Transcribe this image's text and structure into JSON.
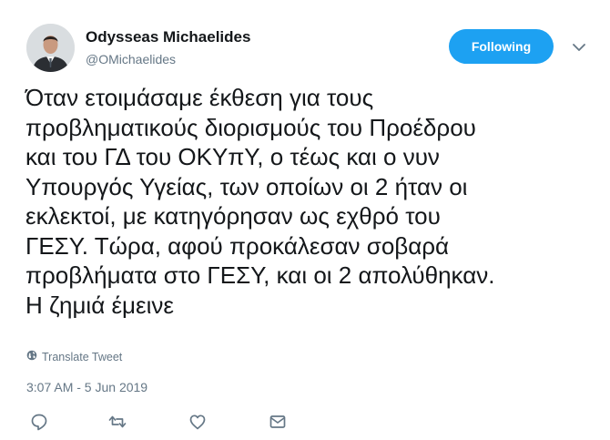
{
  "user": {
    "name": "Odysseas Michaelides",
    "handle": "@OMichaelides"
  },
  "follow_button": {
    "label": "Following",
    "color": "#1da1f2"
  },
  "tweet": {
    "lines": [
      "Όταν ετοιμάσαμε έκθεση για τους",
      "προβληματικούς διορισμούς του Προέδρου",
      "και του ΓΔ του ΟΚΥπΥ, ο τέως και ο νυν",
      "Υπουργός Υγείας, των οποίων οι 2 ήταν οι",
      "εκλεκτοί, με κατηγόρησαν ως εχθρό του",
      "ΓΕΣΥ. Τώρα, αφού προκάλεσαν σοβαρά",
      "προβλήματα στο ΓΕΣΥ, και οι 2 απολύθηκαν.",
      "Η ζημιά έμεινε"
    ],
    "translate_label": "Translate Tweet",
    "timestamp": "3:07 AM - 5 Jun 2019"
  },
  "icons": {
    "caret": "chevron-down-icon",
    "globe": "globe-icon",
    "reply": "reply-icon",
    "retweet": "retweet-icon",
    "like": "heart-icon",
    "message": "envelope-icon"
  },
  "colors": {
    "text": "#14171a",
    "muted": "#657786",
    "accent": "#1da1f2"
  }
}
